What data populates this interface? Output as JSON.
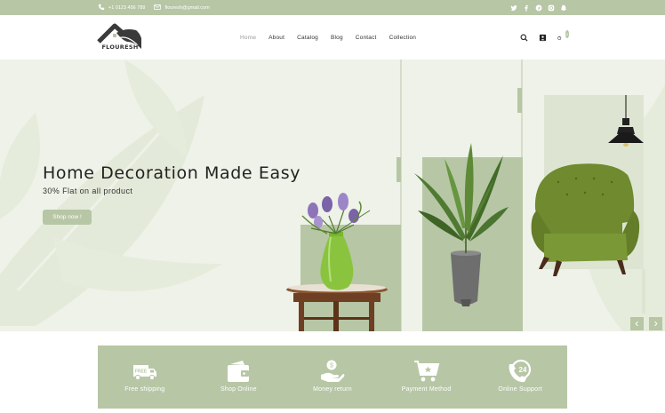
{
  "topbar": {
    "phone": "+1 0123 456 789",
    "email": "flouresh@gmail.com",
    "social_icons": [
      "twitter-icon",
      "facebook-icon",
      "pinterest-icon",
      "instagram-icon",
      "snapchat-icon"
    ]
  },
  "header": {
    "logo_text": "FLOURESH",
    "nav": [
      "Home",
      "About",
      "Catalog",
      "Blog",
      "Contact",
      "Collection"
    ],
    "active_nav": "Home",
    "cart_count": "0"
  },
  "hero": {
    "title": "Home Decoration Made Easy",
    "subtitle": "30% Flat on all product",
    "button_label": "Shop now !"
  },
  "features": [
    {
      "label": "Free shipping",
      "icon": "truck-icon",
      "badge": "FREE"
    },
    {
      "label": "Shop Online",
      "icon": "wallet-icon"
    },
    {
      "label": "Money return",
      "icon": "money-hand-icon"
    },
    {
      "label": "Payment Method",
      "icon": "cart-icon"
    },
    {
      "label": "Online Support",
      "icon": "support-24-icon",
      "badge": "24"
    }
  ],
  "colors": {
    "accent": "#b7c6a5",
    "hero_bg": "#eef2e8",
    "plant_green": "#5e7d3a",
    "chair_green": "#6f8a2f",
    "wood": "#7a4a2a"
  }
}
